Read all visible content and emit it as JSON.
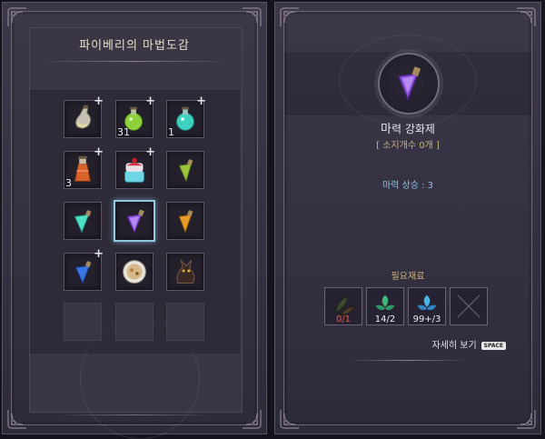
{
  "collection": {
    "title": "파이베리의 마법도감",
    "slots": [
      {
        "icon": "potion-flask-icon",
        "has_plus": true,
        "count": ""
      },
      {
        "icon": "green-potion-icon",
        "has_plus": true,
        "count": "31"
      },
      {
        "icon": "teal-potion-icon",
        "has_plus": true,
        "count": "1"
      },
      {
        "icon": "orange-potion-icon",
        "has_plus": true,
        "count": "3"
      },
      {
        "icon": "cake-jar-icon",
        "has_plus": true,
        "count": ""
      },
      {
        "icon": "green-gem-icon",
        "has_plus": false,
        "count": ""
      },
      {
        "icon": "teal-gem-icon",
        "has_plus": false,
        "count": ""
      },
      {
        "icon": "purple-gem-icon",
        "has_plus": false,
        "count": ""
      },
      {
        "icon": "orange-gem-icon",
        "has_plus": false,
        "count": ""
      },
      {
        "icon": "blue-gem-icon",
        "has_plus": true,
        "count": ""
      },
      {
        "icon": "soup-bowl-icon",
        "has_plus": false,
        "count": ""
      },
      {
        "icon": "dragon-figure-icon",
        "has_plus": false,
        "count": ""
      },
      {
        "icon": "empty-slot",
        "has_plus": false,
        "count": ""
      },
      {
        "icon": "empty-slot",
        "has_plus": false,
        "count": ""
      },
      {
        "icon": "empty-slot",
        "has_plus": false,
        "count": ""
      }
    ],
    "plus_glyph": "+"
  },
  "detail": {
    "item_icon": "purple-gem-icon",
    "item_name_first": "마",
    "item_name_rest": "력 강화제",
    "owned_text": "[ 소지개수 0개 ]",
    "stat_text": "마력 상승 : 3",
    "required_label": "필요재료",
    "materials": [
      {
        "icon": "dark-herb-icon",
        "qty": "0/1",
        "insufficient": true
      },
      {
        "icon": "green-leaf-icon",
        "qty": "14/2",
        "insufficient": false
      },
      {
        "icon": "blue-leaf-icon",
        "qty": "99+/3",
        "insufficient": false
      },
      {
        "icon": "empty-cross-icon",
        "qty": "",
        "insufficient": false
      }
    ],
    "detail_link": "자세히 보기",
    "key_hint": "SPACE"
  },
  "colors": {
    "panel_bg": "#3a3646",
    "gold_text": "#c9b27a",
    "stat_text": "#86c4d8",
    "selected_border": "#8ec9df",
    "insufficient_red": "#e8554a"
  }
}
